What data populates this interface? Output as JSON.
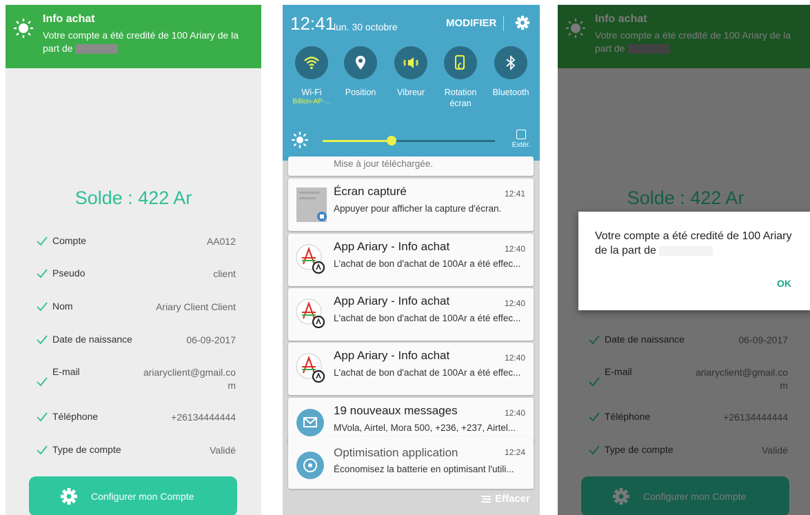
{
  "banner": {
    "title": "Info achat",
    "message": "Votre compte a été credité de 100 Ariary de la part de"
  },
  "profile": {
    "solde": "Solde : 422 Ar",
    "rows": [
      {
        "label": "Compte",
        "value": "AA012"
      },
      {
        "label": "Pseudo",
        "value": "client"
      },
      {
        "label": "Nom",
        "value": "Ariary Client Client"
      },
      {
        "label": "Date de naissance",
        "value": "06-09-2017"
      },
      {
        "label": "E-mail",
        "value": "ariaryclient@gmail.co",
        "value2": "m"
      },
      {
        "label": "Téléphone",
        "value": "+26134444444"
      },
      {
        "label": "Type de compte",
        "value": "Validé"
      }
    ],
    "configure_button": "Configurer mon Compte"
  },
  "shade": {
    "time": "12:41",
    "date": "lun. 30 octobre",
    "modifier": "MODIFIER",
    "quick_settings": [
      {
        "label": "Wi-Fi",
        "sub": "Billion-AP-...",
        "icon": "wifi-icon"
      },
      {
        "label": "Position",
        "sub": "",
        "icon": "location-icon"
      },
      {
        "label": "Vibreur",
        "sub": "",
        "icon": "vibrate-icon"
      },
      {
        "label": "Rotation",
        "sub": "écran",
        "icon": "rotation-icon"
      },
      {
        "label": "Bluetooth",
        "sub": "",
        "icon": "bluetooth-icon"
      }
    ],
    "brightness": 0.4,
    "ext_label": "Extér.",
    "accent": "#e9f24a"
  },
  "notifications": {
    "partial_top": "Mise à jour téléchargée.",
    "items": [
      {
        "title": "Écran capturé",
        "time": "12:41",
        "text": "Appuyer pour afficher la capture d'écran.",
        "icon": "screenshot-icon"
      },
      {
        "title": "App Ariary - Info achat",
        "time": "12:40",
        "text": "L'achat de bon d'achat de 100Ar a été effec...",
        "icon": "ariary-app-icon"
      },
      {
        "title": "App Ariary - Info achat",
        "time": "12:40",
        "text": "L'achat de bon d'achat de 100Ar a été effec...",
        "icon": "ariary-app-icon"
      },
      {
        "title": "App Ariary - Info achat",
        "time": "12:40",
        "text": "L'achat de bon d'achat de 100Ar a été effec...",
        "icon": "ariary-app-icon"
      },
      {
        "title": "19 nouveaux messages",
        "time": "12:40",
        "text": "MVola, Airtel, Mora 500, +236, +237, Airtel...",
        "icon": "message-icon"
      },
      {
        "title": "Optimisation application",
        "time": "12:24",
        "text": "Économisez la batterie en optimisant l'utili...",
        "icon": "optimize-icon"
      }
    ],
    "effacer": "Effacer"
  },
  "dialog": {
    "message": "Votre compte a été credité de 100 Ariary de la part de",
    "ok": "OK"
  }
}
